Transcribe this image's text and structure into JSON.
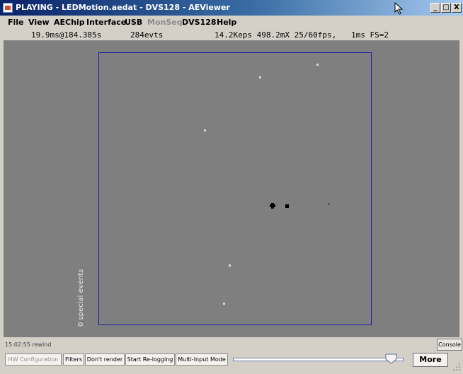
{
  "window": {
    "title": "PLAYING - LEDMotion.aedat - DVS128 - AEViewer",
    "controls": [
      "_",
      "□",
      "X"
    ]
  },
  "menu": [
    {
      "label": "File",
      "enabled": true
    },
    {
      "label": "View",
      "enabled": true
    },
    {
      "label": "AEChip",
      "enabled": true
    },
    {
      "label": "Interface",
      "enabled": true
    },
    {
      "label": "USB",
      "enabled": true
    },
    {
      "label": "MonSeq",
      "enabled": false
    },
    {
      "label": "DVS128",
      "enabled": true
    },
    {
      "label": "Help",
      "enabled": true
    }
  ],
  "status": {
    "time": "19.9ms@184.385s",
    "events": "284evts",
    "rates": "14.2Keps 498.2mX 25/60fps,",
    "frame": "1ms FS=2"
  },
  "display": {
    "background_color": "#7f7f7f",
    "frame_color": "#1a1aaa",
    "special_events": "0 special events"
  },
  "log": {
    "text": "15:02:55 rewind",
    "console_label": "Console"
  },
  "toolbar": {
    "hw_config": "HW Configuration",
    "filters": "Filters",
    "dont_render": "Don't render",
    "start_relogging": "Start Re-logging",
    "multi_input": "Multi-Input Mode",
    "more": "More",
    "slider_value": 0.96
  }
}
